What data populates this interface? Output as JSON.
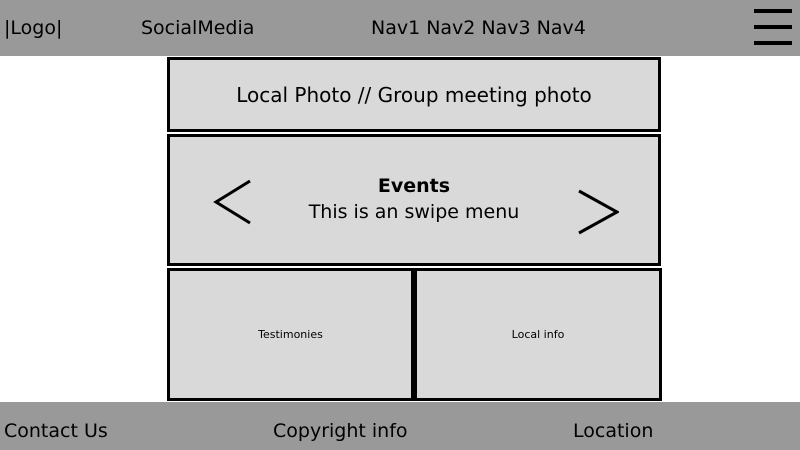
{
  "header": {
    "logo": "|Logo|",
    "social": "SocialMedia",
    "nav": [
      "Nav1",
      "Nav2",
      "Nav3",
      "Nav4"
    ],
    "menu_icon": "hamburger-menu-icon"
  },
  "main": {
    "photo_label": "Local Photo // Group meeting photo",
    "events": {
      "title": "Events",
      "subtitle": "This is an swipe menu",
      "prev_icon": "chevron-left-icon",
      "next_icon": "chevron-right-icon"
    },
    "testimonies_label": "Testimonies",
    "local_info_label": "Local info"
  },
  "footer": {
    "contact": "Contact Us",
    "copyright": "Copyright info",
    "location": "Location"
  },
  "colors": {
    "bar_background": "#999999",
    "panel_background": "#d9d9d9",
    "border": "#000000"
  }
}
